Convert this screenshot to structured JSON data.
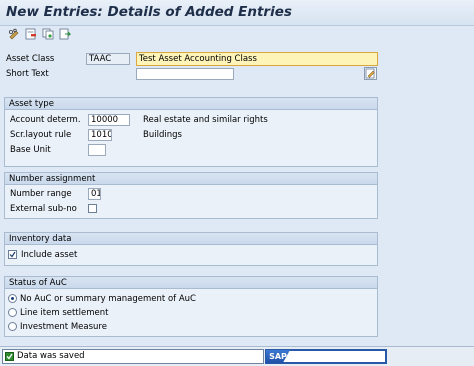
{
  "window": {
    "title": "New Entries: Details of Added Entries"
  },
  "toolbar": {
    "icons": [
      "pencil-glasses-icon",
      "delete-row-icon",
      "copy-icon",
      "export-icon"
    ]
  },
  "header": {
    "asset_class_label": "Asset Class",
    "asset_class_value": "TAAC",
    "asset_class_text": "Test Asset Accounting Class",
    "short_text_label": "Short Text",
    "short_text_value": ""
  },
  "asset_type": {
    "title": "Asset type",
    "account_determ_label": "Account determ.",
    "account_determ_value": "10000",
    "account_determ_desc": "Real estate and similar rights",
    "scr_layout_label": "Scr.layout rule",
    "scr_layout_value": "1010",
    "scr_layout_desc": "Buildings",
    "base_unit_label": "Base Unit",
    "base_unit_value": ""
  },
  "number_assignment": {
    "title": "Number assignment",
    "number_range_label": "Number range",
    "number_range_value": "01",
    "external_subno_label": "External sub-no",
    "external_subno_checked": false
  },
  "inventory": {
    "title": "Inventory data",
    "include_asset_label": "Include asset",
    "include_asset_checked": true
  },
  "auc": {
    "title": "Status of AuC",
    "options": [
      "No AuC or summary management of AuC",
      "Line item settlement",
      "Investment Measure"
    ],
    "selected": 0
  },
  "status": {
    "message": "Data was saved",
    "logo": "SAP"
  },
  "colors": {
    "background": "#dfe9f5",
    "highlight": "#fff4b8",
    "success": "#2e8b2e",
    "brand": "#1e4fa6"
  }
}
